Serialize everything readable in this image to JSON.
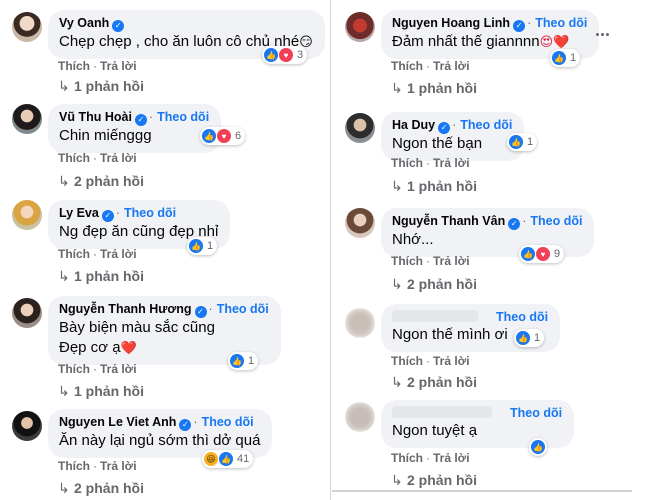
{
  "follow_label": "Theo dõi",
  "left_column": [
    {
      "name": "Vy Oanh",
      "follow": false,
      "lines": [
        "Chẹp chẹp , cho ăn luôn cô chủ nhé"
      ],
      "emoji": "😏",
      "reactions": [
        "like",
        "love"
      ],
      "count": "3",
      "like_label": "Thích",
      "reply_label": "Trả lời",
      "replies": "1 phản hồi"
    },
    {
      "name": "Vũ Thu Hoài",
      "follow": true,
      "lines": [
        "Chin miếnggg"
      ],
      "reactions": [
        "like",
        "love"
      ],
      "count": "6",
      "like_label": "Thích",
      "reply_label": "Trả lời",
      "replies": "2 phản hồi"
    },
    {
      "name": "Ly Eva",
      "follow": true,
      "lines": [
        "Ng đẹp ăn cũng đẹp nhỉ"
      ],
      "reactions": [
        "like"
      ],
      "count": "1",
      "like_label": "Thích",
      "reply_label": "Trả lời",
      "replies": "1 phản hồi"
    },
    {
      "name": "Nguyễn Thanh Hương",
      "follow": true,
      "lines": [
        "Bày biện màu sắc cũng",
        "Đẹp cơ ạ"
      ],
      "emoji": "❤️",
      "reactions": [
        "like"
      ],
      "count": "1",
      "like_label": "Thích",
      "reply_label": "Trả lời",
      "replies": "1 phản hồi"
    },
    {
      "name": "Nguyen Le Viet Anh",
      "follow": true,
      "lines": [
        "Ăn này lại ngủ sớm thì dở quá"
      ],
      "reactions": [
        "haha",
        "like"
      ],
      "count": "41",
      "like_label": "Thích",
      "reply_label": "Trả lời",
      "replies": "2 phản hồi"
    }
  ],
  "right_column": [
    {
      "name": "Nguyen Hoang Linh",
      "follow": true,
      "lines": [
        "Đảm nhất thế giannnn"
      ],
      "emoji": "😍❤️",
      "reactions": [
        "like"
      ],
      "count": "1",
      "like_label": "Thích",
      "reply_label": "Trả lời",
      "replies": "1 phản hồi"
    },
    {
      "name": "Ha Duy",
      "follow": true,
      "lines": [
        "Ngon thế bạn"
      ],
      "reactions": [
        "like"
      ],
      "count": "1",
      "like_label": "Thích",
      "reply_label": "Trả lời",
      "replies": "1 phản hồi"
    },
    {
      "name": "Nguyễn Thanh Vân",
      "follow": true,
      "lines": [
        "Nhớ..."
      ],
      "reactions": [
        "like",
        "love"
      ],
      "count": "9",
      "like_label": "Thích",
      "reply_label": "Trả lời",
      "replies": "2 phản hồi"
    },
    {
      "name": "",
      "follow": true,
      "lines": [
        "Ngon thế mình ơi"
      ],
      "reactions": [
        "like"
      ],
      "count": "1",
      "like_label": "Thích",
      "reply_label": "Trả lời",
      "replies": "2 phản hồi"
    },
    {
      "name": "",
      "follow": true,
      "lines": [
        "Ngon tuyệt ạ"
      ],
      "reactions": [
        "like"
      ],
      "count": "",
      "like_label": "Thích",
      "reply_label": "Trả lời",
      "replies": "2 phản hồi"
    }
  ],
  "icons": {
    "more": "more-options-icon",
    "reply_arrow": "reply-arrow-icon",
    "verified": "verified-badge-icon"
  },
  "colors": {
    "link": "#1877f2",
    "bubble": "#f0f2f5",
    "secondary_text": "#65676b",
    "like": "#1877f2",
    "love": "#f33e58",
    "haha": "#f7b125"
  }
}
